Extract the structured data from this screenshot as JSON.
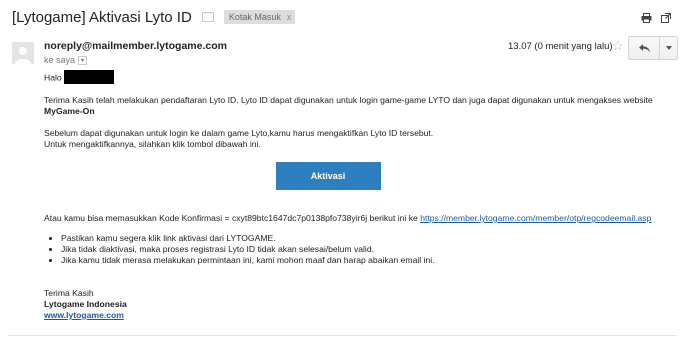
{
  "header": {
    "subject": "[Lytogame] Aktivasi Lyto ID",
    "label": "Kotak Masuk",
    "label_close": "x"
  },
  "message": {
    "sender": "noreply@mailmember.lytogame.com",
    "recipient": "ke saya",
    "time": "13.07 (0 menit yang lalu)",
    "greeting": "Halo",
    "para1a": "Terima Kasih telah melakukan pendaftaran Lyto ID. Lyto ID dapat digunakan untuk login game-game LYTO dan juga dapat digunakan untuk mengakses website",
    "para1b": "MyGame-On",
    "para2a": "Sebelum dapat digunakan untuk login ke dalam game Lyto,kamu harus mengaktifkan Lyto ID tersebut.",
    "para2b": "Untuk mengaktifkannya, silahkan klik tombol dibawah ini.",
    "activate_button": "Aktivasi",
    "code_text": "Atau kamu bisa memasukkan Kode Konfirmasi = cxyt89btc1647dc7p0138pfo738yir6j berikut ini ke",
    "code_link": "https://member.lytogame.com/member/otp/regcodeemail.asp",
    "bullets": [
      "Pastikan kamu segera klik link aktivasi dari LYTOGAME.",
      "Jika tidak diaktivasi, maka proses registrasi Lyto ID tidak akan selesai/belum valid.",
      "Jika kamu tidak merasa melakukan permintaan ini, kami mohon maaf dan harap abaikan email ini."
    ],
    "signoff": "Terima Kasih",
    "company": "Lytogame Indonesia",
    "website": "www.lytogame.com"
  }
}
